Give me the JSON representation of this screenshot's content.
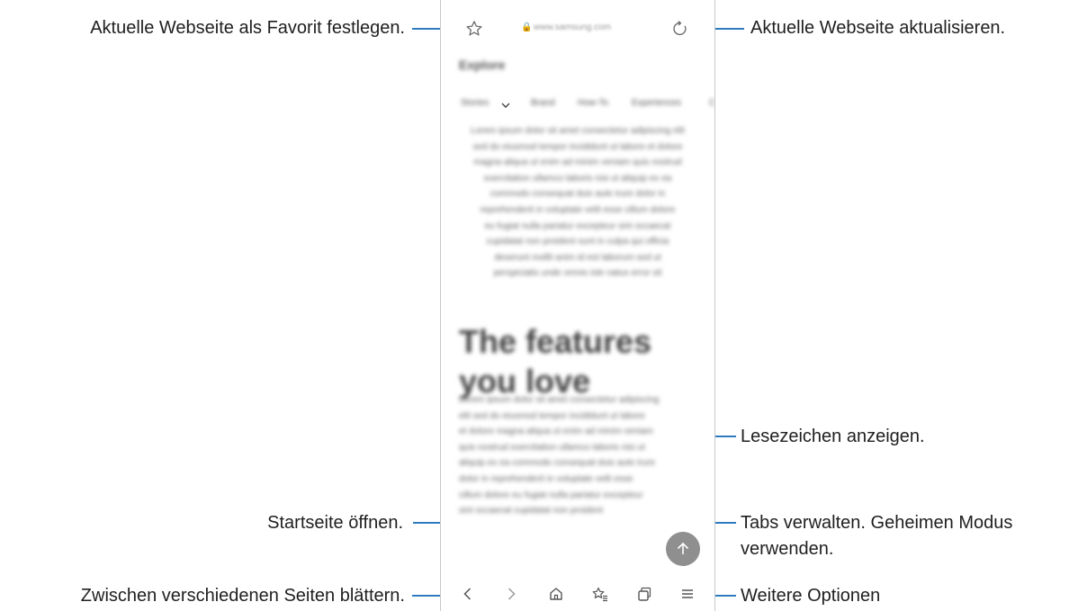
{
  "callouts": {
    "favorite": "Aktuelle Webseite als Favorit festlegen.",
    "refresh": "Aktuelle Webseite aktualisieren.",
    "bookmarks": "Lesezeichen anzeigen.",
    "home": "Startseite öffnen.",
    "tabs_line1": "Tabs verwalten. Geheimen Modus",
    "tabs_line2": "verwenden.",
    "navigate": "Zwischen verschiedenen Seiten blättern.",
    "more": "Weitere Optionen"
  },
  "browser": {
    "url": "www.samsung.com",
    "site_title": "Explore",
    "tabs": [
      "Stories",
      "Brand",
      "How-To",
      "Experiences",
      "C"
    ],
    "paragraph1_lines": [
      "Lorem ipsum dolor sit amet consectetur adipiscing elit",
      "sed do eiusmod tempor incididunt ut labore et dolore",
      "magna aliqua ut enim ad minim veniam quis nostrud",
      "exercitation ullamco laboris nisi ut aliquip ex ea",
      "commodo consequat duis aute irure dolor in",
      "reprehenderit in voluptate velit esse cillum dolore",
      "eu fugiat nulla pariatur excepteur sint occaecat",
      "cupidatat non proident sunt in culpa qui officia",
      "deserunt mollit anim id est laborum sed ut",
      "perspiciatis unde omnis iste natus error sit"
    ],
    "headline": "The features you love",
    "paragraph2_lines": [
      "Lorem ipsum dolor sit amet consectetur adipiscing",
      "elit sed do eiusmod tempor incididunt ut labore",
      "et dolore magna aliqua ut enim ad minim veniam",
      "quis nostrud exercitation ullamco laboris nisi ut",
      "aliquip ex ea commodo consequat duis aute irure",
      "dolor in reprehenderit in voluptate velit esse",
      "cillum dolore eu fugiat nulla pariatur excepteur",
      "sint occaecat cupidatat non proident"
    ]
  },
  "colors": {
    "leader": "#2e7bbf",
    "icon": "#6b6b6b",
    "scroll_button": "#8f8f8f"
  },
  "icons": {
    "favorite": "star-icon",
    "refresh": "reload-icon",
    "back": "chevron-left-icon",
    "forward": "chevron-right-icon",
    "home": "home-icon",
    "bookmarks": "bookmark-list-icon",
    "tabs": "tabs-icon",
    "menu": "hamburger-menu-icon",
    "scroll_top": "arrow-up-icon"
  }
}
